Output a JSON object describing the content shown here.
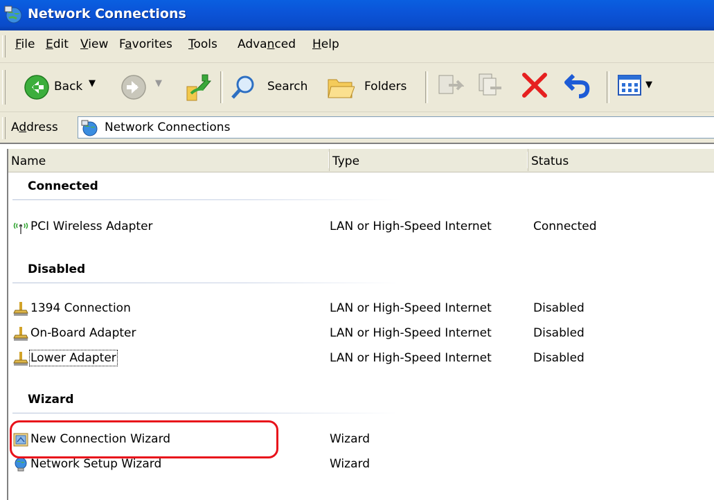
{
  "window": {
    "title": "Network Connections",
    "icon": "network-globe-icon"
  },
  "menu": [
    "File",
    "Edit",
    "View",
    "Favorites",
    "Tools",
    "Advanced",
    "Help"
  ],
  "toolbar": {
    "back_label": "Back",
    "search_label": "Search",
    "folders_label": "Folders"
  },
  "address": {
    "label": "Address",
    "value": "Network Connections"
  },
  "columns": {
    "name": "Name",
    "type": "Type",
    "status": "Status"
  },
  "groups": {
    "connected": "Connected",
    "disabled": "Disabled",
    "wizard": "Wizard"
  },
  "items": [
    {
      "name": "PCI Wireless Adapter",
      "type": "LAN or High-Speed Internet",
      "status": "Connected",
      "icon": "wireless-adapter-icon"
    },
    {
      "name": "1394 Connection",
      "type": "LAN or High-Speed Internet",
      "status": "Disabled",
      "icon": "network-adapter-icon"
    },
    {
      "name": "On-Board Adapter",
      "type": "LAN or High-Speed Internet",
      "status": "Disabled",
      "icon": "network-adapter-icon"
    },
    {
      "name": "Lower Adapter",
      "type": "LAN or High-Speed Internet",
      "status": "Disabled",
      "icon": "network-adapter-icon"
    },
    {
      "name": "New Connection Wizard",
      "type": "Wizard",
      "status": "",
      "icon": "connection-wizard-icon"
    },
    {
      "name": "Network Setup Wizard",
      "type": "Wizard",
      "status": "",
      "icon": "setup-wizard-icon"
    }
  ],
  "colors": {
    "title_bar": "#0a54d8",
    "highlight": "#e8121b",
    "chrome": "#ece9d8"
  }
}
